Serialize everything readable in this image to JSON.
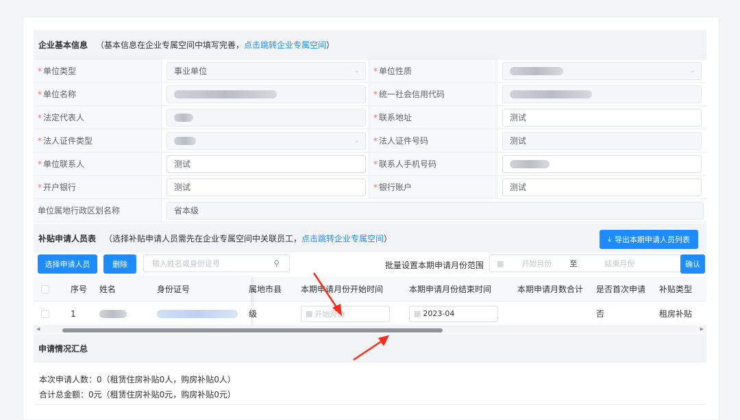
{
  "basic_info": {
    "title": "企业基本信息",
    "note_prefix": "（基本信息在企业专属空间中填写完善，",
    "link": "点击跳转企业专属空间",
    "note_suffix": "）",
    "fields": [
      {
        "label": "单位类型",
        "required": "*",
        "value": "事业单位",
        "type": "select"
      },
      {
        "label": "单位性质",
        "required": "*",
        "value": "",
        "type": "select-redacted"
      },
      {
        "label": "单位名称",
        "required": "*",
        "value": "",
        "type": "redacted"
      },
      {
        "label": "统一社会信用代码",
        "required": "*",
        "value": "",
        "type": "redacted"
      },
      {
        "label": "法定代表人",
        "required": "*",
        "value": "",
        "type": "redacted"
      },
      {
        "label": "联系地址",
        "required": "*",
        "value": "测试",
        "type": "input"
      },
      {
        "label": "法人证件类型",
        "required": "*",
        "value": "",
        "type": "select-redacted"
      },
      {
        "label": "法人证件号码",
        "required": "*",
        "value": "测试",
        "type": "disabled"
      },
      {
        "label": "单位联系人",
        "required": "*",
        "value": "测试",
        "type": "input"
      },
      {
        "label": "联系人手机号码",
        "required": "*",
        "value": "",
        "type": "input-redacted"
      },
      {
        "label": "开户银行",
        "required": "*",
        "value": "测试",
        "type": "input"
      },
      {
        "label": "银行账户",
        "required": "*",
        "value": "测试",
        "type": "input"
      },
      {
        "label": "单位属地行政区划名称",
        "required": "",
        "value": "省本级",
        "type": "disabled"
      }
    ]
  },
  "applicants": {
    "title": "补贴申请人员表",
    "note_prefix": "（选择补贴申请人员需先在企业专属空间中关联员工，",
    "link": "点击跳转企业专属空间",
    "note_suffix": "）",
    "export_button": "导出本期申请人员列表",
    "export_icon": "download-icon",
    "select_button": "选择申请人员",
    "delete_button": "删除",
    "search_placeholder": "输入姓名或身份证号",
    "range_label": "批量设置本期申请月份范围",
    "range_start_placeholder": "开始月份",
    "range_sep": "至",
    "range_end_placeholder": "结束月份",
    "confirm_button": "确认",
    "columns": [
      "序号",
      "姓名",
      "身份证号",
      "属地市县",
      "本期申请月份开始时间",
      "本期申请月份结束时间",
      "本期申请月数合计",
      "是否首次申请",
      "补贴类型"
    ],
    "rows": [
      {
        "index": "1",
        "city": "级",
        "start_placeholder": "开始月份",
        "end": "2023-04",
        "months": "",
        "first": "否",
        "type": "租房补贴"
      }
    ]
  },
  "summary": {
    "title": "申请情况汇总",
    "line1": "本次申请人数：0（租赁住房补贴0人，购房补贴0人）",
    "line2": "合计总金额：0元（租赁住房补贴0元，购房补贴0元）"
  },
  "colors": {
    "primary": "#1e8cff",
    "required": "#f56c6c",
    "annotation": "#ff2a1a"
  }
}
